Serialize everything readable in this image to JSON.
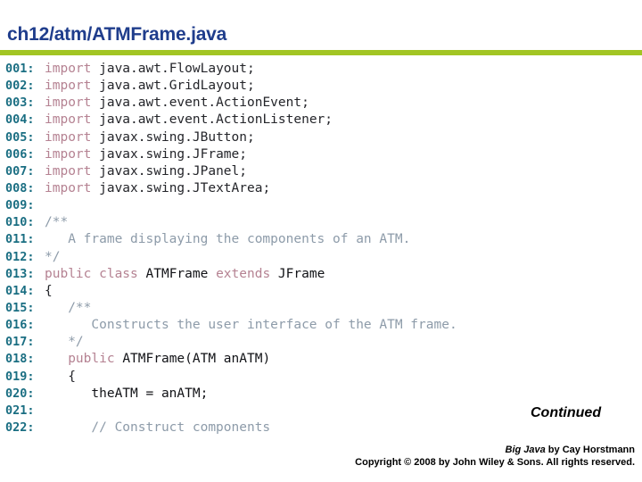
{
  "header": {
    "title": "ch12/atm/ATMFrame.java",
    "rule_color": "#A2C523",
    "title_color": "#1F3D8C"
  },
  "code": {
    "language": "java",
    "line_number_color": "#1A6E82",
    "keyword_color": "#B58292",
    "comment_color": "#8D9BA9",
    "text_color": "#24252A",
    "lines": [
      {
        "num": "001:",
        "tokens": [
          {
            "t": "import",
            "k": "kw"
          },
          {
            "t": " java.awt.FlowLayout;",
            "k": "txt"
          }
        ]
      },
      {
        "num": "002:",
        "tokens": [
          {
            "t": "import",
            "k": "kw"
          },
          {
            "t": " java.awt.GridLayout;",
            "k": "txt"
          }
        ]
      },
      {
        "num": "003:",
        "tokens": [
          {
            "t": "import",
            "k": "kw"
          },
          {
            "t": " java.awt.event.ActionEvent;",
            "k": "txt"
          }
        ]
      },
      {
        "num": "004:",
        "tokens": [
          {
            "t": "import",
            "k": "kw"
          },
          {
            "t": " java.awt.event.ActionListener;",
            "k": "txt"
          }
        ]
      },
      {
        "num": "005:",
        "tokens": [
          {
            "t": "import",
            "k": "kw"
          },
          {
            "t": " javax.swing.JButton;",
            "k": "txt"
          }
        ]
      },
      {
        "num": "006:",
        "tokens": [
          {
            "t": "import",
            "k": "kw"
          },
          {
            "t": " javax.swing.JFrame;",
            "k": "txt"
          }
        ]
      },
      {
        "num": "007:",
        "tokens": [
          {
            "t": "import",
            "k": "kw"
          },
          {
            "t": " javax.swing.JPanel;",
            "k": "txt"
          }
        ]
      },
      {
        "num": "008:",
        "tokens": [
          {
            "t": "import",
            "k": "kw"
          },
          {
            "t": " javax.swing.JTextArea;",
            "k": "txt"
          }
        ]
      },
      {
        "num": "009:",
        "tokens": []
      },
      {
        "num": "010:",
        "tokens": [
          {
            "t": "/**",
            "k": "cmt"
          }
        ]
      },
      {
        "num": "011:",
        "tokens": [
          {
            "t": "   A frame displaying the components of an ATM.",
            "k": "cmt"
          }
        ]
      },
      {
        "num": "012:",
        "tokens": [
          {
            "t": "*/",
            "k": "cmt"
          }
        ]
      },
      {
        "num": "013:",
        "tokens": [
          {
            "t": "public class ",
            "k": "kw"
          },
          {
            "t": "ATMFrame",
            "k": "id"
          },
          {
            "t": " extends ",
            "k": "kw"
          },
          {
            "t": "JFrame",
            "k": "id"
          }
        ]
      },
      {
        "num": "014:",
        "tokens": [
          {
            "t": "{",
            "k": "txt"
          }
        ]
      },
      {
        "num": "015:",
        "tokens": [
          {
            "t": "   /**",
            "k": "cmt"
          }
        ]
      },
      {
        "num": "016:",
        "tokens": [
          {
            "t": "      Constructs the user interface of the ATM frame.",
            "k": "cmt"
          }
        ]
      },
      {
        "num": "017:",
        "tokens": [
          {
            "t": "   */",
            "k": "cmt"
          }
        ]
      },
      {
        "num": "018:",
        "tokens": [
          {
            "t": "   ",
            "k": "txt"
          },
          {
            "t": "public ",
            "k": "kw"
          },
          {
            "t": "ATMFrame(ATM anATM)",
            "k": "id"
          }
        ]
      },
      {
        "num": "019:",
        "tokens": [
          {
            "t": "   {",
            "k": "txt"
          }
        ]
      },
      {
        "num": "020:",
        "tokens": [
          {
            "t": "      theATM = anATM;",
            "k": "id"
          }
        ]
      },
      {
        "num": "021:",
        "tokens": []
      },
      {
        "num": "022:",
        "tokens": [
          {
            "t": "      // Construct components",
            "k": "cmt"
          }
        ]
      }
    ]
  },
  "continued": {
    "label": "Continued"
  },
  "footer": {
    "book_title": "Big Java",
    "book_byline": " by Cay Horstmann",
    "copyright": "Copyright © 2008 by John Wiley & Sons.  All rights reserved."
  }
}
